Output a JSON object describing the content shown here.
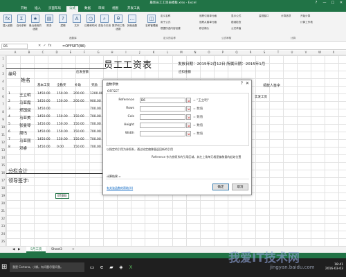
{
  "window": {
    "title": "最新员工工资表模板.xlsx - Excel",
    "controls": [
      "?",
      "—",
      "□",
      "✕"
    ]
  },
  "tabs": [
    "开始",
    "插入",
    "页面布局",
    "公式",
    "数据",
    "审阅",
    "视图",
    "开发工具"
  ],
  "ribbon": {
    "buttons": [
      "插入函数",
      "自动求和",
      "最近使用的函数",
      "财务",
      "逻辑",
      "文本",
      "日期和时间",
      "查找与引用",
      "数学和三角函数",
      "其他函数",
      "名称管理器"
    ],
    "small": [
      "定义名称",
      "用于公式",
      "根据所选内容创建",
      "追踪引用单元格",
      "追踪从属单元格",
      "移去箭头",
      "显示公式",
      "错误检查",
      "公式求值",
      "监视窗口",
      "计算选项",
      "开始计算",
      "计算工作表"
    ],
    "groups": [
      "函数库",
      "定义的名称",
      "公式审核",
      "计算"
    ]
  },
  "formula_bar": {
    "name_box": "B5",
    "cancel": "✕",
    "enter": "✓",
    "fx": "fx",
    "formula": "=OFFSET(B6)"
  },
  "columns": [
    "A",
    "B",
    "C",
    "D",
    "E",
    "F",
    "G",
    "H",
    "I",
    "J",
    "K",
    "L",
    "M",
    "N",
    "O",
    "P",
    "Q",
    "R",
    "S",
    "T",
    "U",
    "V",
    "W",
    "X"
  ],
  "rows": [
    "1",
    "2",
    "3",
    "4",
    "5",
    "6",
    "7",
    "8",
    "9",
    "10",
    "11",
    "12",
    "13",
    "14",
    "15",
    "16",
    "17",
    "18",
    "19",
    "20",
    "21",
    "22",
    "23",
    "24",
    "25"
  ],
  "sheet": {
    "title": "员工工资表",
    "date": "发放日期：2015年2月12日  所属日期：2015年1月",
    "header_no": "编号",
    "header_name": "姓名",
    "header_group1": "应发金额",
    "header_group2": "应扣金额",
    "header_actual": "实发工资",
    "header_sign": "领款人签字",
    "sub_headers": [
      "基本工资",
      "全勤奖",
      "补助",
      "奖励"
    ],
    "employees": [
      {
        "no": "1",
        "name": "王立明",
        "v1": "1450.00",
        "v2": "150.00",
        "v3": "200.00",
        "v4": "1200.00"
      },
      {
        "no": "2",
        "name": "马亚霞",
        "v1": "1450.00",
        "v2": "150.00",
        "v3": "200.00",
        "v4": "900.00"
      },
      {
        "no": "3",
        "name": "郑国斌",
        "v1": "1450.00",
        "v2": "",
        "v3": "",
        "v4": "700.00"
      },
      {
        "no": "4",
        "name": "马亚美",
        "v1": "1450.00",
        "v2": "150.00",
        "v3": "150.00",
        "v4": "700.00"
      },
      {
        "no": "5",
        "name": "张曼琴",
        "v1": "1450.00",
        "v2": "150.00",
        "v3": "150.00",
        "v4": "700.00"
      },
      {
        "no": "6",
        "name": "周玛",
        "v1": "1450.00",
        "v2": "150.00",
        "v3": "150.00",
        "v4": "700.00"
      },
      {
        "no": "7",
        "name": "马亚丽",
        "v1": "1450.00",
        "v2": "150.00",
        "v3": "150.00",
        "v4": "700.00"
      },
      {
        "no": "8",
        "name": "邓睿",
        "v1": "1450.00",
        "v2": "0.00",
        "v3": "150.00",
        "v4": "700.00"
      }
    ],
    "subtotal": "分栏合计",
    "leader": "领导签字:",
    "cell_bb": "BT(B6)"
  },
  "dialog": {
    "title": "函数参数",
    "help": "?",
    "close": "✕",
    "function_name": "OFFSET",
    "args": [
      {
        "label": "Reference",
        "value": "B6",
        "result": "= \"王立明\""
      },
      {
        "label": "Rows",
        "value": "",
        "result": "= 数值"
      },
      {
        "label": "Cols",
        "value": "",
        "result": "= 数值"
      },
      {
        "label": "Height",
        "value": "",
        "result": "= 数值"
      },
      {
        "label": "Width",
        "value": "",
        "result": "= 数值"
      }
    ],
    "desc1": "以指定的引用为参照系，通过给定偏移量返回新的引用",
    "desc2": "Reference  作为参照系的引用区域，其左上角单元格是偏移量的起始位置",
    "calc_result": "计算结果 =",
    "help_link": "有关该函数的帮助(H)",
    "ok": "确定",
    "cancel": "取消"
  },
  "sheet_tabs": [
    "5月工资",
    "Sheet3"
  ],
  "add_sheet": "+",
  "taskbar": {
    "start": "⊞",
    "search": "我是 Cortana，小娜。有问题尽管问我。",
    "time": "18:41",
    "date": "2016-03-03"
  },
  "watermark": "我爱IT技术网",
  "watermark2": "jingyan.baidu.com"
}
